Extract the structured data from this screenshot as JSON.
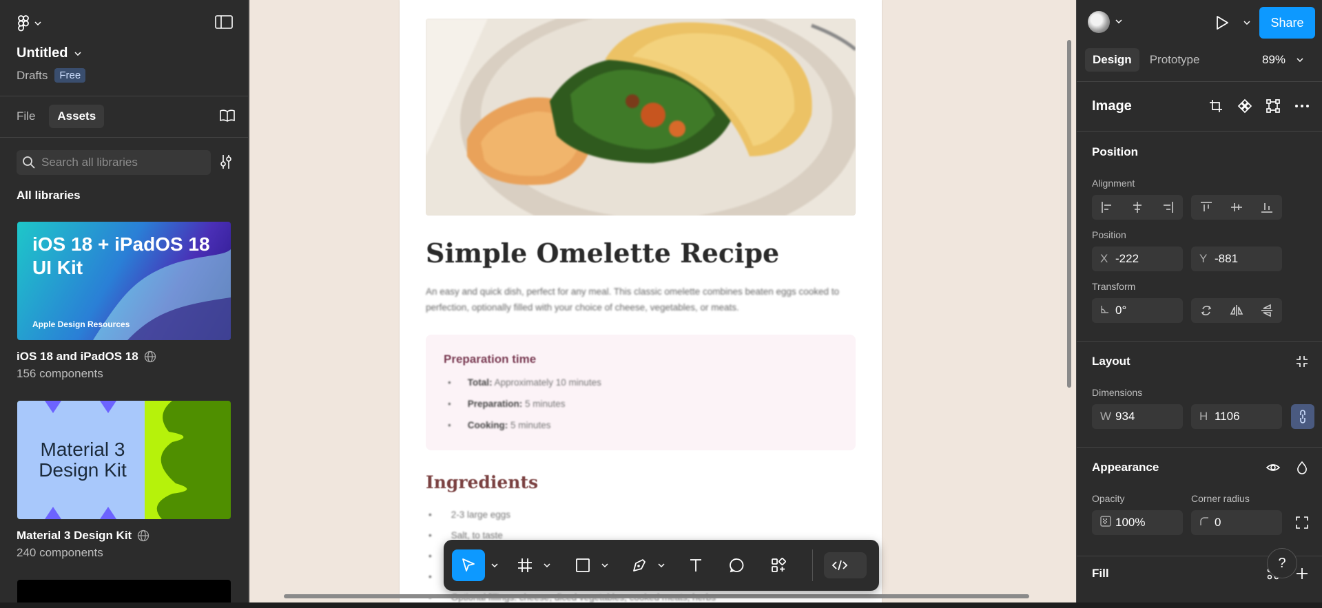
{
  "app": {
    "file_title": "Untitled",
    "location": "Drafts",
    "plan_badge": "Free"
  },
  "left_panel": {
    "tabs": [
      {
        "label": "File"
      },
      {
        "label": "Assets"
      }
    ],
    "search_placeholder": "Search all libraries",
    "section_title": "All libraries",
    "libraries": [
      {
        "card_title": "iOS 18 + iPadOS 18 UI Kit",
        "card_footer": "Apple Design Resources",
        "name": "iOS 18 and iPadOS 18",
        "count": "156 components"
      },
      {
        "card_title": "Material 3 Design Kit",
        "name": "Material 3 Design Kit",
        "count": "240 components"
      }
    ]
  },
  "canvas": {
    "recipe_title": "Simple Omelette Recipe",
    "description": "An easy and quick dish, perfect for any meal. This classic omelette combines beaten eggs cooked to perfection, optionally filled with your choice of cheese, vegetables, or meats.",
    "prep": {
      "title": "Preparation time",
      "items": [
        {
          "label": "Total:",
          "value": "Approximately 10 minutes"
        },
        {
          "label": "Preparation:",
          "value": "5 minutes"
        },
        {
          "label": "Cooking:",
          "value": "5 minutes"
        }
      ]
    },
    "ingredients_title": "Ingredients",
    "ingredients": [
      "2-3 large eggs",
      "Salt, to taste",
      "",
      "",
      "Optional fillings: cheese, diced vegetables, cooked meats, herbs"
    ]
  },
  "right_panel": {
    "share_label": "Share",
    "tabs": [
      {
        "label": "Design"
      },
      {
        "label": "Prototype"
      }
    ],
    "zoom": "89%",
    "layer_type": "Image",
    "position_section": "Position",
    "alignment_label": "Alignment",
    "position_label": "Position",
    "x_key": "X",
    "x_value": "-222",
    "y_key": "Y",
    "y_value": "-881",
    "transform_label": "Transform",
    "rotation_value": "0°",
    "layout_section": "Layout",
    "dimensions_label": "Dimensions",
    "w_key": "W",
    "w_value": "934",
    "h_key": "H",
    "h_value": "1106",
    "appearance_section": "Appearance",
    "opacity_label": "Opacity",
    "opacity_value": "100%",
    "corner_label": "Corner radius",
    "corner_value": "0",
    "fill_section": "Fill",
    "help_label": "?"
  },
  "colors": {
    "accent": "#0d99ff",
    "panel": "#2c2c2c",
    "canvas": "#f0e6dd"
  }
}
